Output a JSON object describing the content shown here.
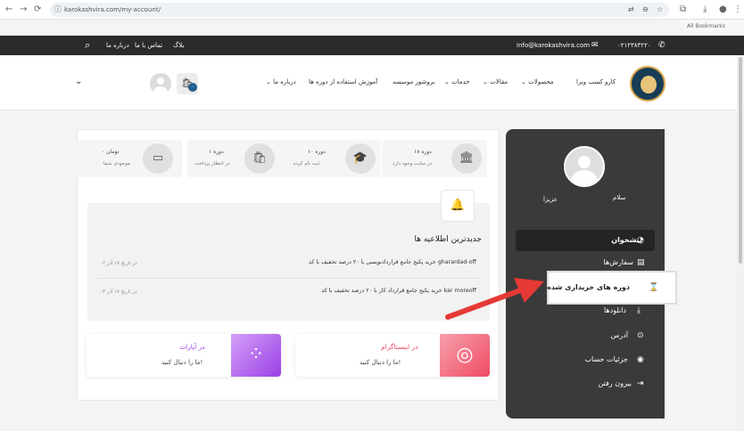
{
  "browser": {
    "url": "karokashvira.com/my-account/",
    "back_icon": "←",
    "forward_icon": "→",
    "reload_icon": "⟳",
    "info_icon": "ⓘ",
    "translate_icon": "⇄",
    "zoom_icon": "⊖",
    "star_icon": "☆",
    "ext_icon": "⧉",
    "download_icon": "⤓",
    "profile_icon": "●",
    "menu_icon": "⋮",
    "bookmark_label": "All Bookmarks"
  },
  "topbar": {
    "phone": "۰۲۱۲۳۸۳۲۲۰",
    "phone_icon": "✆",
    "email": "info@karokashvira.com",
    "email_icon": "✉",
    "links": [
      "بلاگ",
      "تماس با ما",
      "درباره ما"
    ],
    "search_icon": "⌕"
  },
  "header": {
    "menu": [
      {
        "label": "کارو کسب ویرا",
        "arrow": ""
      },
      {
        "label": "محصولات",
        "arrow": "⌄"
      },
      {
        "label": "مقالات",
        "arrow": "⌄"
      },
      {
        "label": "خدمات",
        "arrow": "⌄"
      },
      {
        "label": "بروشور موسسه",
        "arrow": ""
      },
      {
        "label": "آموزش استفاده از دوره ها",
        "arrow": ""
      },
      {
        "label": "درباره ما",
        "arrow": "⌄"
      }
    ],
    "cart_icon": "🛍",
    "cart_count": "۰",
    "dropdown_icon": "⌄"
  },
  "sidebar": {
    "greeting": "سلام",
    "username": "عزیزا",
    "items": [
      {
        "label": "پیشخوان",
        "icon": "◔"
      },
      {
        "label": "سفارش‌ها",
        "icon": "▤"
      },
      {
        "label": "دوره های خریداری شده",
        "icon": "⌛"
      },
      {
        "label": "دانلودها",
        "icon": "⤓"
      },
      {
        "label": "آدرس",
        "icon": "⊙"
      },
      {
        "label": "جزئیات حساب",
        "icon": "◉"
      },
      {
        "label": "بیرون رفتن",
        "icon": "⇥"
      }
    ]
  },
  "stats": [
    {
      "value": "۱۸ دوره",
      "label": "در سایت وجود دارد",
      "icon": "🏛"
    },
    {
      "value": "۱۰ دوره",
      "label": "ثبت نام کرده اید",
      "icon": "🎓"
    },
    {
      "value": "۱ دوره",
      "label": "در انتظار پرداخت",
      "icon": "🛍"
    },
    {
      "value": "۰ تومان",
      "label": "موجودی شما",
      "icon": "▭"
    }
  ],
  "notifications": {
    "bell_icon": "🔔",
    "title": "جدیدترین اطلاعیه ها",
    "items": [
      {
        "text": "خرید پکیج جامع قراردادنویسی با ۲۰ درصد تخفیف با کد gharardad-off",
        "date": "در تاریخ ۱۷ آذر ۰۲"
      },
      {
        "text": "خرید پکیج جامع قرارداد کار با ۲۰ درصد تخفیف با کد kar moreoff",
        "date": "در تاریخ ۱۷ آذر ۰۳"
      }
    ]
  },
  "social": [
    {
      "title": "در اینستاگرام",
      "subtitle": "ما را دنبال کنید!",
      "icon": "◎"
    },
    {
      "title": "در آپارات",
      "subtitle": "ما را دنبال کنید!",
      "icon": "⁘"
    }
  ],
  "colors": {
    "sidebar": "#3a3a3a",
    "topbar": "#2b2b2b",
    "instagram": "#f0556a",
    "aparat": "#a04ae8",
    "arrow": "#e53935"
  }
}
